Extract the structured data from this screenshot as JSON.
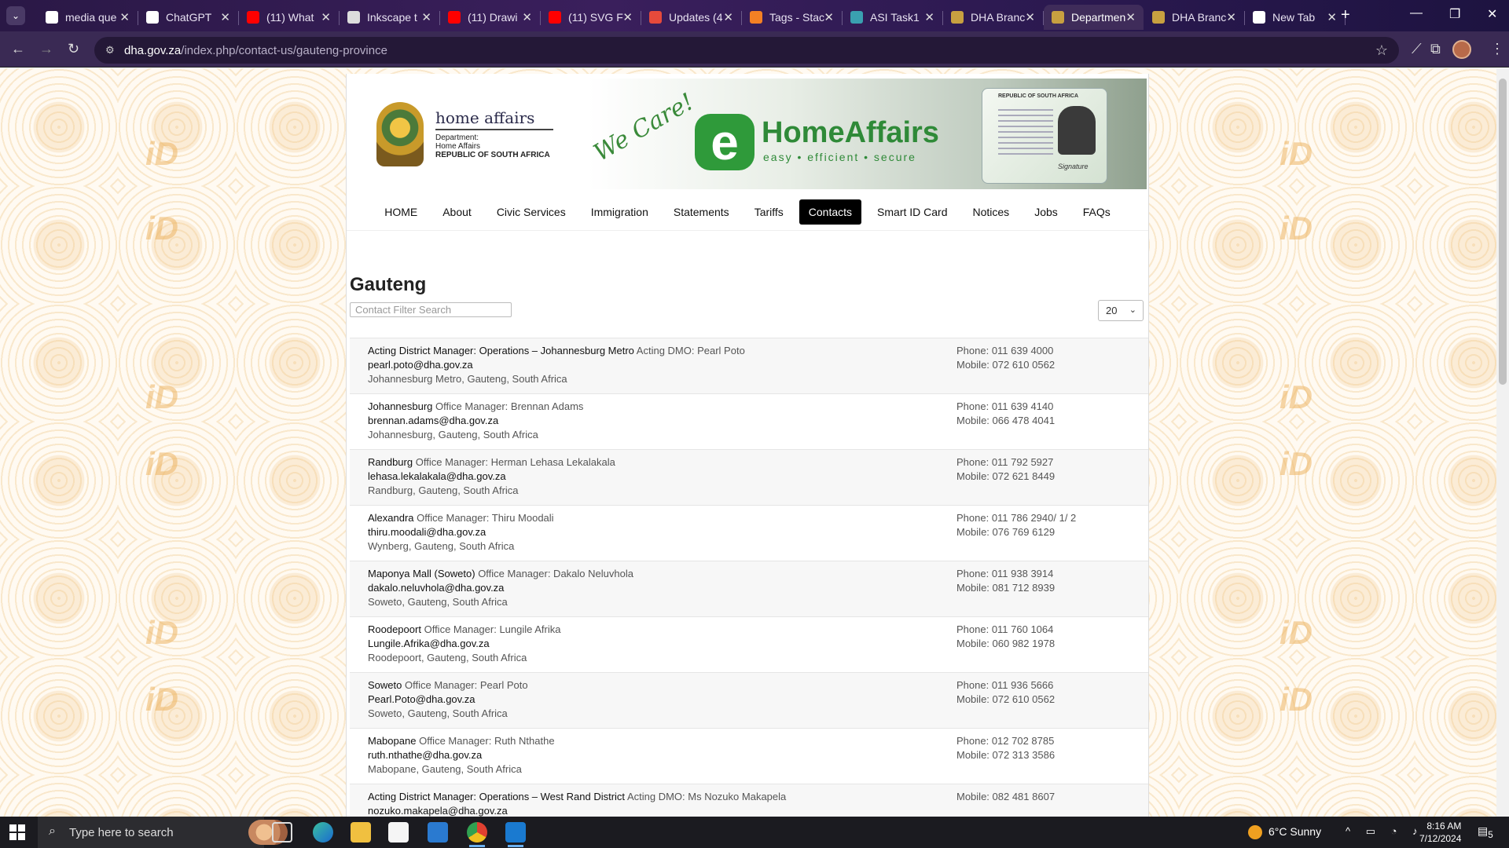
{
  "browser": {
    "tabs": [
      {
        "label": "media que",
        "favicon": "google-icon",
        "color": "#ffffff"
      },
      {
        "label": "ChatGPT",
        "favicon": "chatgpt-icon",
        "color": "#ffffff"
      },
      {
        "label": "(11) What",
        "favicon": "youtube-icon",
        "color": "#ff0000"
      },
      {
        "label": "Inkscape t",
        "favicon": "inkscape-icon",
        "color": "#dddddd"
      },
      {
        "label": "(11) Drawi",
        "favicon": "youtube-icon",
        "color": "#ff0000"
      },
      {
        "label": "(11) SVG F",
        "favicon": "youtube-icon",
        "color": "#ff0000"
      },
      {
        "label": "Updates (4",
        "favicon": "gmail-icon",
        "color": "#e64a3b"
      },
      {
        "label": "Tags - Stac",
        "favicon": "stackoverflow-icon",
        "color": "#f48024"
      },
      {
        "label": "ASI Task1",
        "favicon": "asi-icon",
        "color": "#3aa0b0"
      },
      {
        "label": "DHA Branc",
        "favicon": "dha-icon",
        "color": "#c8a040"
      },
      {
        "label": "Departmen",
        "favicon": "dha-icon",
        "color": "#c8a040",
        "active": true
      },
      {
        "label": "DHA Branc",
        "favicon": "dha-icon",
        "color": "#c8a040"
      },
      {
        "label": "New Tab",
        "favicon": "chrome-icon",
        "color": "#ffffff"
      }
    ],
    "url_host": "dha.gov.za",
    "url_path": "/index.php/contact-us/gauteng-province"
  },
  "header": {
    "dept_title": "home affairs",
    "dept_line1": "Department:",
    "dept_line2": "Home Affairs",
    "dept_line3": "REPUBLIC OF SOUTH AFRICA",
    "slogan": "We Care!",
    "ehome_letter": "e",
    "ehome_title": "HomeAffairs",
    "ehome_tagline": "easy • efficient • secure",
    "idcard_title": "REPUBLIC OF SOUTH AFRICA",
    "idcard_signature": "Signature"
  },
  "nav": [
    "HOME",
    "About",
    "Civic Services",
    "Immigration",
    "Statements",
    "Tariffs",
    "Contacts",
    "Smart ID Card",
    "Notices",
    "Jobs",
    "FAQs"
  ],
  "nav_active": "Contacts",
  "page_title": "Gauteng",
  "filter_placeholder": "Contact Filter Search",
  "display_limit": "20",
  "contacts": [
    {
      "position": "Acting District Manager: Operations – Johannesburg Metro",
      "role": "Acting DMO: Pearl Poto",
      "email": "pearl.poto@dha.gov.za",
      "address": "Johannesburg Metro, Gauteng, South Africa",
      "phone": "Phone: 011 639 4000",
      "mobile": "Mobile: 072 610 0562"
    },
    {
      "position": "Johannesburg",
      "role": "Office Manager: Brennan Adams",
      "email": "brennan.adams@dha.gov.za",
      "address": "Johannesburg, Gauteng, South Africa",
      "phone": "Phone: 011 639 4140",
      "mobile": "Mobile: 066 478 4041"
    },
    {
      "position": "Randburg",
      "role": "Office Manager: Herman Lehasa Lekalakala",
      "email": "lehasa.lekalakala@dha.gov.za",
      "address": "Randburg, Gauteng, South Africa",
      "phone": "Phone: 011 792 5927",
      "mobile": "Mobile: 072 621 8449"
    },
    {
      "position": "Alexandra",
      "role": "Office Manager: Thiru Moodali",
      "email": "thiru.moodali@dha.gov.za",
      "address": "Wynberg, Gauteng, South Africa",
      "phone": "Phone: 011 786 2940/ 1/ 2",
      "mobile": "Mobile: 076 769 6129"
    },
    {
      "position": "Maponya Mall (Soweto)",
      "role": "Office Manager: Dakalo Neluvhola",
      "email": "dakalo.neluvhola@dha.gov.za",
      "address": "Soweto, Gauteng, South Africa",
      "phone": "Phone: 011 938 3914",
      "mobile": "Mobile: 081 712 8939"
    },
    {
      "position": "Roodepoort",
      "role": "Office Manager: Lungile Afrika",
      "email": "Lungile.Afrika@dha.gov.za",
      "address": "Roodepoort, Gauteng, South Africa",
      "phone": "Phone: 011 760 1064",
      "mobile": "Mobile: 060 982 1978"
    },
    {
      "position": "Soweto",
      "role": "Office Manager: Pearl Poto",
      "email": "Pearl.Poto@dha.gov.za",
      "address": "Soweto, Gauteng, South Africa",
      "phone": "Phone: 011 936 5666",
      "mobile": "Mobile: 072 610 0562"
    },
    {
      "position": "Mabopane",
      "role": "Office Manager: Ruth Nthathe",
      "email": "ruth.nthathe@dha.gov.za",
      "address": "Mabopane, Gauteng, South Africa",
      "phone": "Phone: 012 702 8785",
      "mobile": "Mobile: 072 313 3586"
    },
    {
      "position": "Acting District Manager: Operations – West Rand District",
      "role": "Acting DMO: Ms Nozuko Makapela",
      "email": "nozuko.makapela@dha.gov.za",
      "address": "",
      "phone": "",
      "mobile": "Mobile: 082 481 8607"
    }
  ],
  "taskbar": {
    "search_placeholder": "Type here to search",
    "weather": "6°C  Sunny",
    "time": "8:16 AM",
    "date": "7/12/2024",
    "notification_count": "5"
  }
}
